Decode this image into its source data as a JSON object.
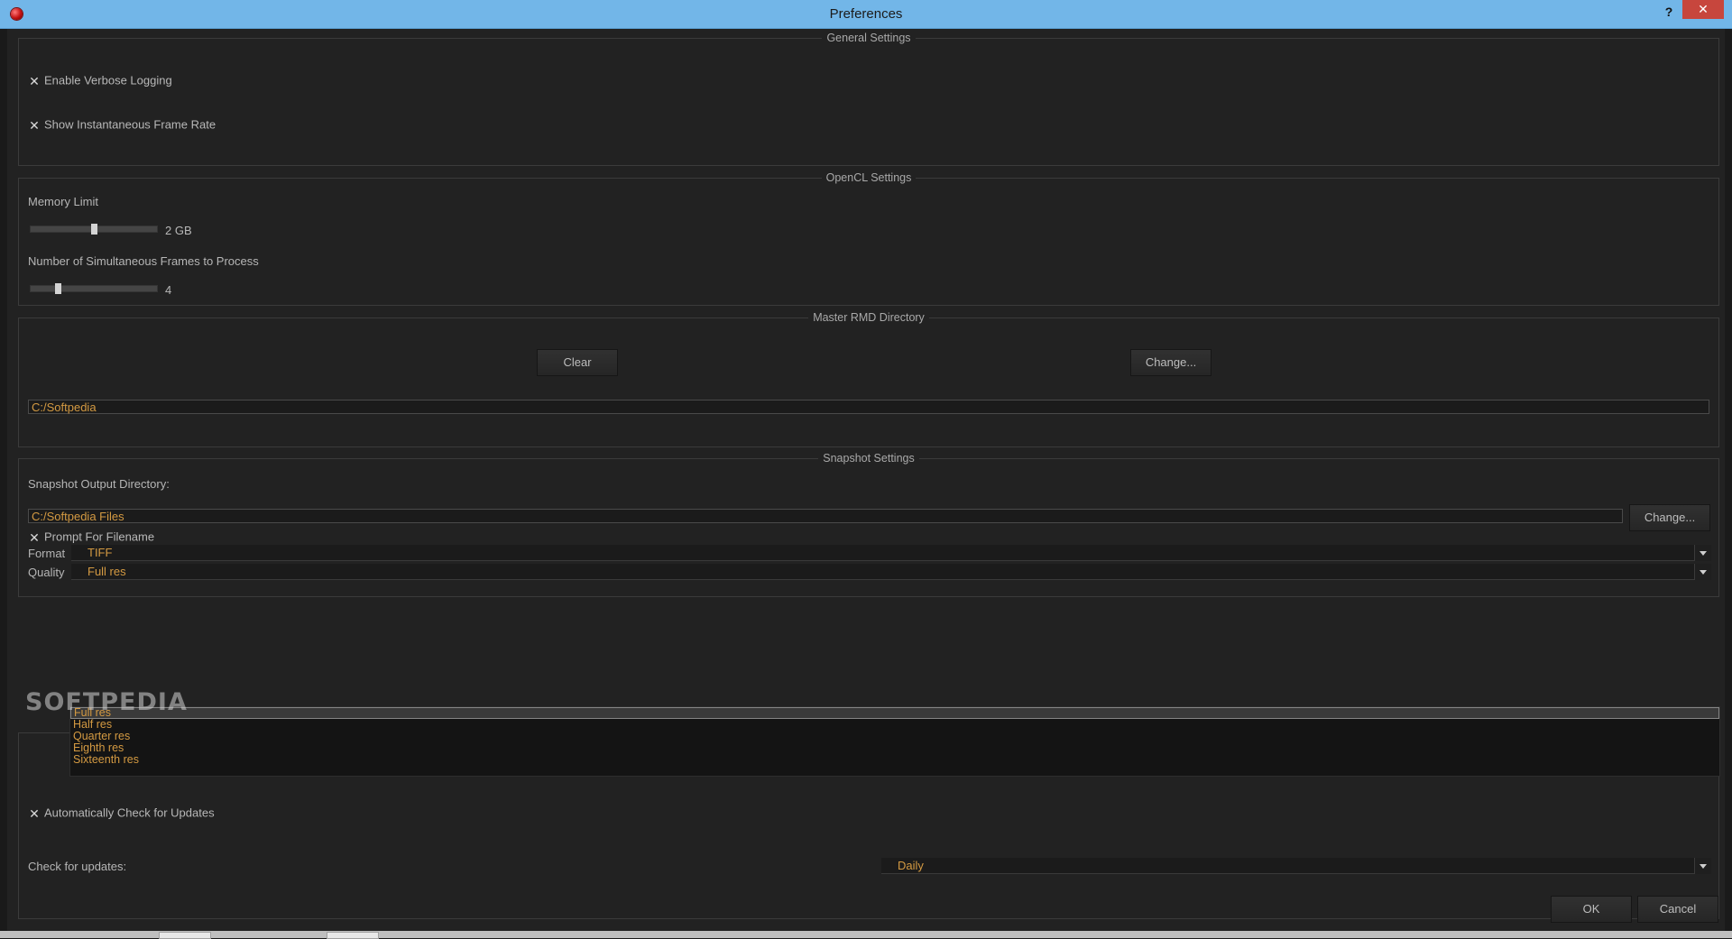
{
  "window": {
    "title": "Preferences",
    "help": "?",
    "close": "✕"
  },
  "general": {
    "title": "General Settings",
    "verbose_logging": {
      "label": "Enable Verbose Logging",
      "checked": true,
      "mark": "✕"
    },
    "instant_frame_rate": {
      "label": "Show Instantaneous Frame Rate",
      "checked": true,
      "mark": "✕"
    }
  },
  "opencl": {
    "title": "OpenCL Settings",
    "memory_limit": {
      "label": "Memory Limit",
      "value": "2 GB",
      "level": 0.5
    },
    "simultaneous_frames": {
      "label": "Number of Simultaneous Frames to Process",
      "value": "4",
      "level": 0.2
    }
  },
  "rmd": {
    "title": "Master RMD Directory",
    "clear_label": "Clear",
    "change_label": "Change...",
    "path": "C:/Softpedia"
  },
  "snapshot": {
    "title": "Snapshot Settings",
    "output_label": "Snapshot Output Directory:",
    "output_path": "C:/Softpedia Files",
    "change_label": "Change...",
    "prompt_filename": {
      "label": "Prompt For Filename",
      "checked": true,
      "mark": "✕"
    },
    "format_label": "Format",
    "format_value": "TIFF",
    "quality_label": "Quality",
    "quality_value": "Full res",
    "quality_options": [
      "Full res",
      "Half res",
      "Quarter res",
      "Eighth res",
      "Sixteenth res"
    ],
    "quality_selected_index": 0
  },
  "updates": {
    "auto_check": {
      "label": "Automatically Check for Updates",
      "checked": true,
      "mark": "✕"
    },
    "check_label": "Check for updates:",
    "check_value": "Daily"
  },
  "footer": {
    "ok_label": "OK",
    "cancel_label": "Cancel"
  },
  "watermark": "SOFTPEDIA",
  "colors": {
    "accent_text": "#d49a42",
    "titlebar": "#72b6e8",
    "close": "#c7463d",
    "panel": "#222222"
  }
}
